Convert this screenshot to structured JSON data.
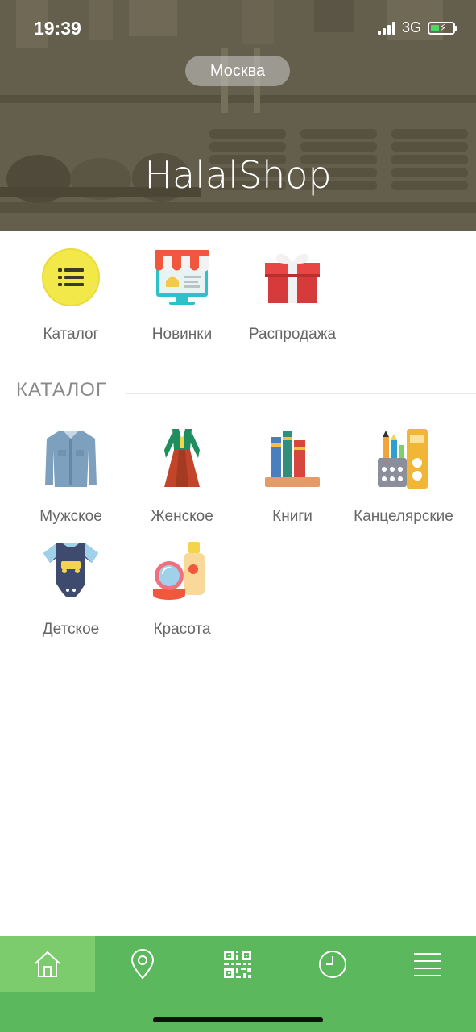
{
  "status": {
    "time": "19:39",
    "network": "3G"
  },
  "header": {
    "city": "Москва",
    "brand": "HalalShop"
  },
  "quick_menu": [
    {
      "label": "Каталог",
      "icon": "list-icon"
    },
    {
      "label": "Новинки",
      "icon": "shop-icon"
    },
    {
      "label": "Распродажа",
      "icon": "gift-icon"
    }
  ],
  "catalog": {
    "title": "КАТАЛОГ",
    "items": [
      {
        "label": "Мужское",
        "icon": "shirt-icon"
      },
      {
        "label": "Женское",
        "icon": "dress-icon"
      },
      {
        "label": "Книги",
        "icon": "books-icon"
      },
      {
        "label": "Канцелярские",
        "icon": "stationery-icon"
      },
      {
        "label": "Детское",
        "icon": "baby-bodysuit-icon"
      },
      {
        "label": "Красота",
        "icon": "cosmetics-icon"
      }
    ]
  },
  "tabbar": [
    {
      "icon": "home-icon",
      "active": true
    },
    {
      "icon": "map-pin-icon",
      "active": false
    },
    {
      "icon": "qr-code-icon",
      "active": false
    },
    {
      "icon": "clock-icon",
      "active": false
    },
    {
      "icon": "menu-icon",
      "active": false
    }
  ],
  "colors": {
    "accent": "#5cb85c",
    "accent_active": "#7ccc6e",
    "header_overlay": "#645e4b"
  }
}
